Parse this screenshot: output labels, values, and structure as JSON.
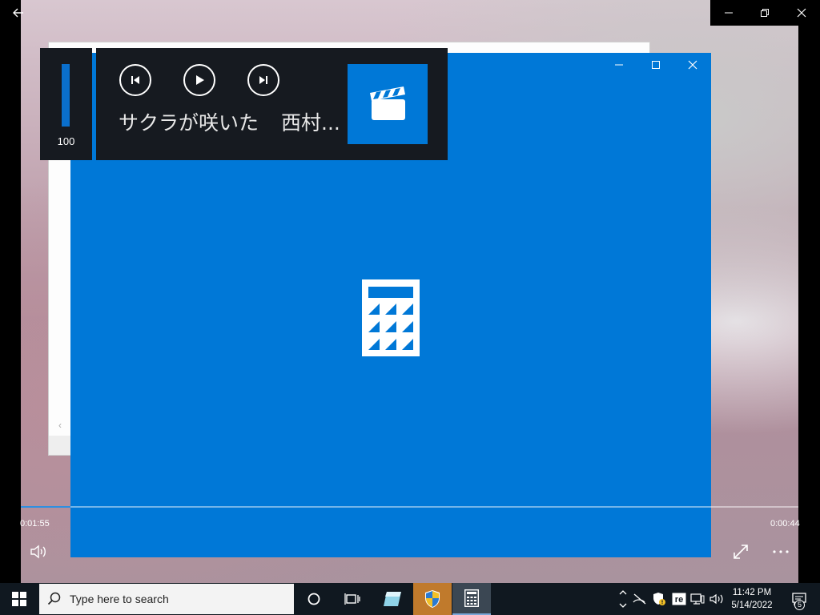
{
  "media_overlay": {
    "volume_value": "100",
    "volume_level": 1.0,
    "title": "サクラが咲いた",
    "artist": "西村...",
    "thumb_icon": "clapperboard-icon"
  },
  "player": {
    "elapsed": "0:01:55",
    "remaining": "0:00:44"
  },
  "calculator": {
    "logo_icon": "calculator-icon",
    "accent": "#0078d7"
  },
  "taskbar": {
    "search_placeholder": "Type here to search",
    "time": "11:42 PM",
    "date": "5/14/2022",
    "notification_count": "5"
  }
}
